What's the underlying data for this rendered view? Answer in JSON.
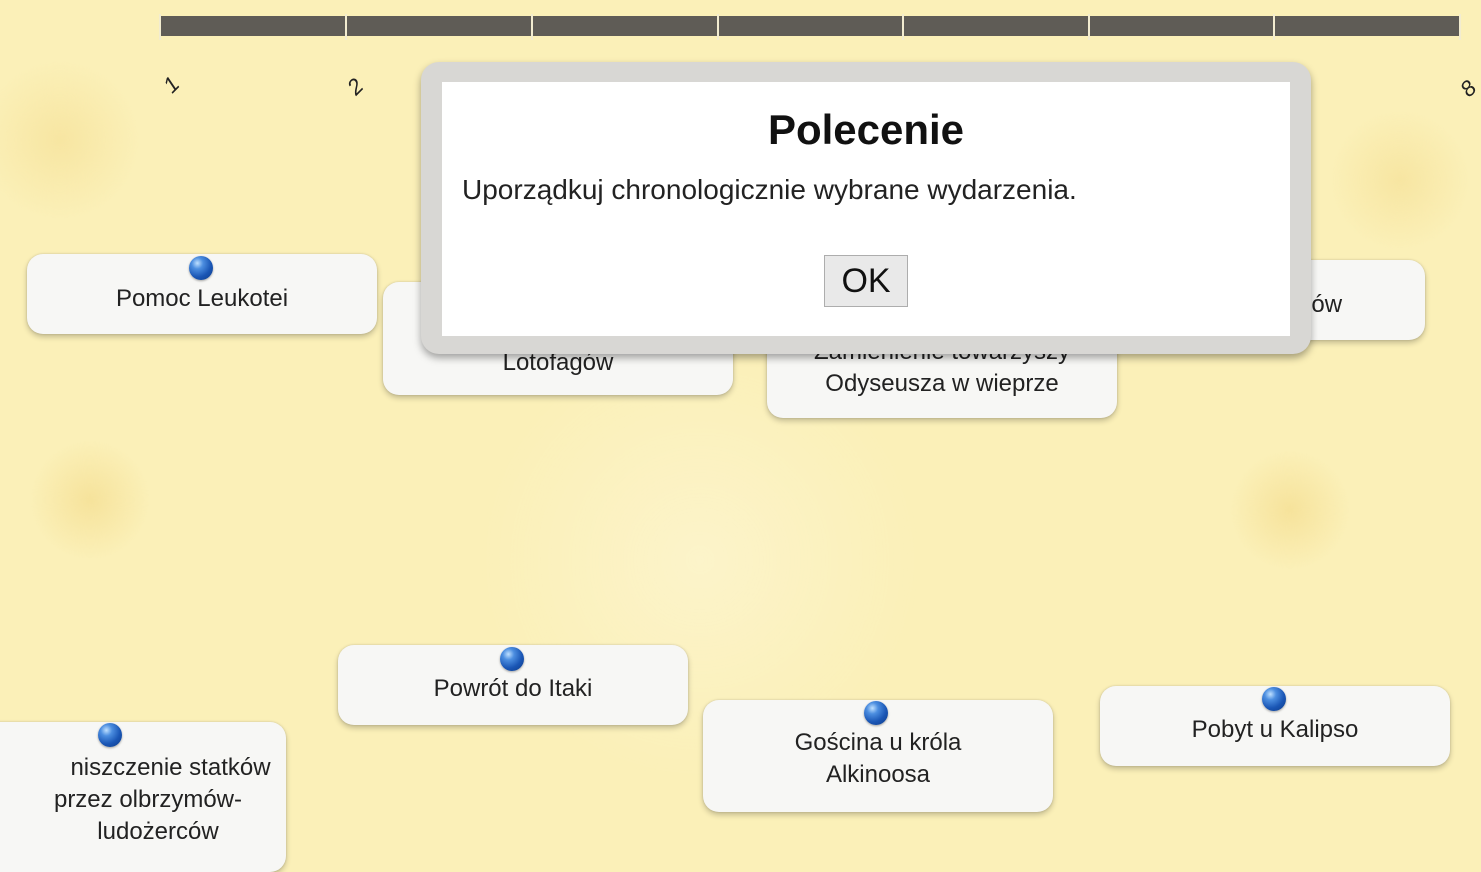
{
  "timeline": {
    "ticks": [
      "1",
      "2",
      "8"
    ]
  },
  "events": [
    {
      "label": "Pomoc Leukotei"
    },
    {
      "label": "Lotofagów"
    },
    {
      "label_top": "Zamienienie towarzyszy",
      "label_bottom": "Odyseusza w wieprze"
    },
    {
      "label": "nów"
    },
    {
      "label": "Powrót do Itaki"
    },
    {
      "label_top": "Gościna u króla",
      "label_bottom": "Alkinoosa"
    },
    {
      "label": "Pobyt u Kalipso"
    },
    {
      "line1": "niszczenie statków",
      "line2": "przez olbrzymów-",
      "line3": "ludożerców"
    }
  ],
  "modal": {
    "title": "Polecenie",
    "text": "Uporządkuj chronologicznie wybrane wydarzenia.",
    "ok_label": "OK"
  },
  "colors": {
    "background": "#fbf0b8",
    "timeline_bar": "#5f5c56",
    "card": "#f7f7f5",
    "pin": "#1a56b5"
  }
}
